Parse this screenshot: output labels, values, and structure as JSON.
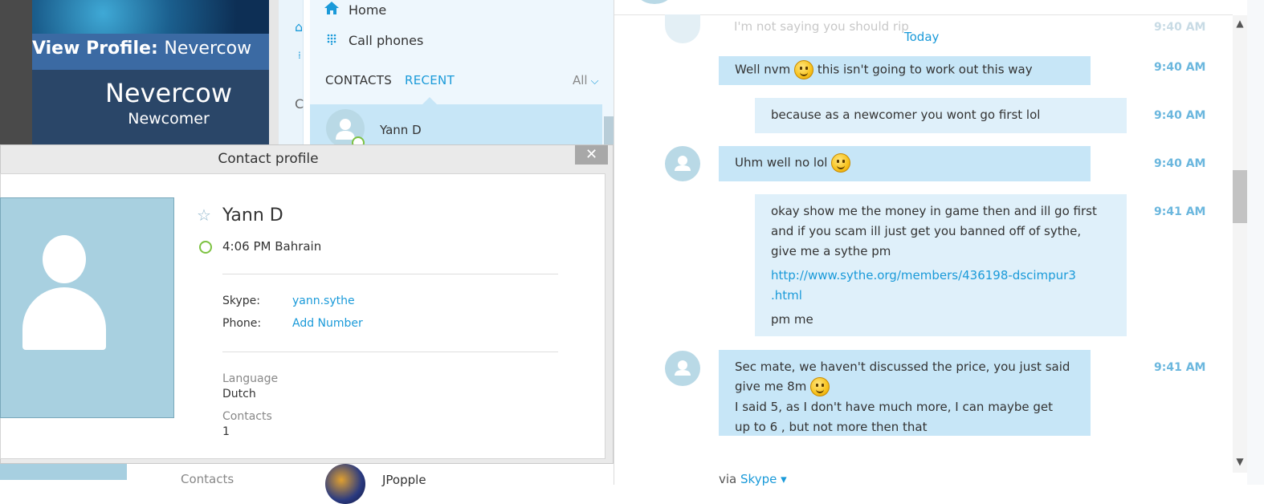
{
  "forum": {
    "view_profile_prefix": "View Profile",
    "view_profile_name": "Nevercow",
    "username": "Nevercow",
    "rank": "Newcomer"
  },
  "sidebar": {
    "home": "Home",
    "call_phones": "Call phones",
    "tabs": {
      "contacts": "CONTACTS",
      "recent": "RECENT"
    },
    "filter": "All",
    "contact_name": "Yann D",
    "partial_letter": "C",
    "bottom_contacts_label": "Contacts",
    "bottom_contact_name": "JPopple"
  },
  "dialog": {
    "title": "Contact profile",
    "close": "✕",
    "name": "Yann D",
    "local_time": "4:06 PM Bahrain",
    "skype_label": "Skype:",
    "skype_value": "yann.sythe",
    "phone_label": "Phone:",
    "phone_value": "Add Number",
    "language_label": "Language",
    "language_value": "Dutch",
    "contacts_label": "Contacts",
    "contacts_value": "1"
  },
  "chat": {
    "ghost_message": "I'm not saying you should rip",
    "ghost_time": "9:40 AM",
    "date_separator": "Today",
    "messages": [
      {
        "from": "them",
        "lines": [
          "Well nvm",
          "this isn't going to work out this way"
        ],
        "time": "9:40 AM"
      },
      {
        "from": "me",
        "lines": [
          "because as a newcomer you wont go first lol"
        ],
        "time": "9:40 AM"
      },
      {
        "from": "them",
        "lines": [
          "Uhm well no lol"
        ],
        "time": "9:40 AM"
      },
      {
        "from": "me",
        "lines": [
          "okay show me the money in game then and ill go first",
          "and if you scam ill just get you banned off of sythe,",
          "give me a sythe pm",
          "http://www.sythe.org/members/436198-dscimpur3",
          ".html",
          "pm me"
        ],
        "time": "9:41 AM"
      },
      {
        "from": "them",
        "lines": [
          "Sec mate, we haven't discussed the price, you just said",
          "give me 8m",
          "I said 5, as I don't have much more, I can maybe get",
          "up to 6 , but not more then that"
        ],
        "time": "9:41 AM"
      }
    ],
    "via_prefix": "via",
    "via_service": "Skype",
    "via_chevron": "▾"
  },
  "icons": {
    "home": "home-icon",
    "dialpad": "dialpad-icon",
    "star": "star-icon",
    "close": "close-icon",
    "chevron": "chevron-down-icon",
    "emoticon": "smile-emoticon-icon",
    "scroll_up": "chevron-up-icon",
    "scroll_down": "chevron-down-icon"
  },
  "colors": {
    "accent": "#1a9ad9",
    "bubble": "#c7e6f7",
    "status_online": "#7dc242"
  }
}
